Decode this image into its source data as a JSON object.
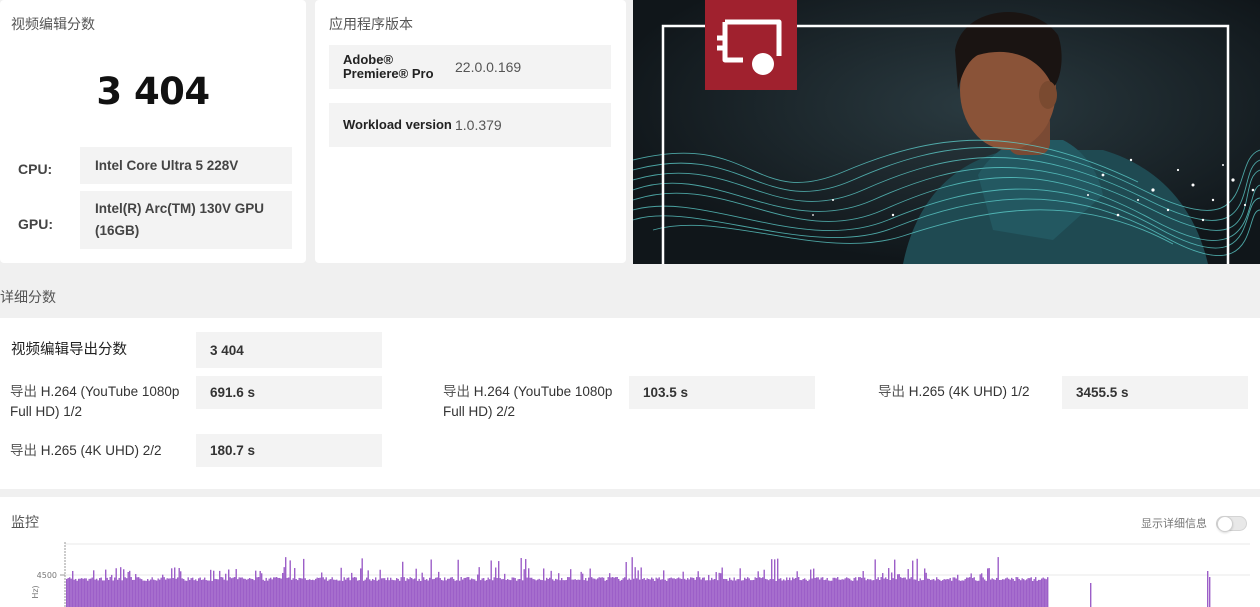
{
  "score_card": {
    "title": "视频编辑分数",
    "score": "3 404",
    "cpu_label": "CPU:",
    "cpu_value": "Intel Core Ultra 5 228V",
    "gpu_label": "GPU:",
    "gpu_value": "Intel(R) Arc(TM) 130V GPU (16GB)"
  },
  "version_card": {
    "title": "应用程序版本",
    "rows": [
      {
        "name": "Adobe® Premiere® Pro",
        "value": "22.0.0.169"
      },
      {
        "name": "Workload version",
        "value": "1.0.379"
      }
    ]
  },
  "detail": {
    "title": "详细分数",
    "main_label": "视频编辑导出分数",
    "main_value": "3 404",
    "items": [
      {
        "prefix": "导出",
        "label": "H.264 (YouTube 1080p Full HD) 1/2",
        "value": "691.6 s"
      },
      {
        "prefix": "导出",
        "label": "H.264 (YouTube 1080p Full HD) 2/2",
        "value": "103.5 s"
      },
      {
        "prefix": "导出",
        "label": "H.265 (4K UHD) 1/2",
        "value": "3455.5 s"
      },
      {
        "prefix": "导出",
        "label": "H.265 (4K UHD) 2/2",
        "value": "180.7 s"
      }
    ]
  },
  "monitor": {
    "title": "监控",
    "toggle_label": "显示详细信息",
    "y_tick": "4500",
    "y_axis_unit": "Hz)"
  },
  "colors": {
    "brand_red": "#a0212e",
    "wave_teal": "#5fd3d0",
    "chart_purple": "#9c5fc8"
  },
  "icons": {
    "hero_icon": "video-editing-icon"
  }
}
